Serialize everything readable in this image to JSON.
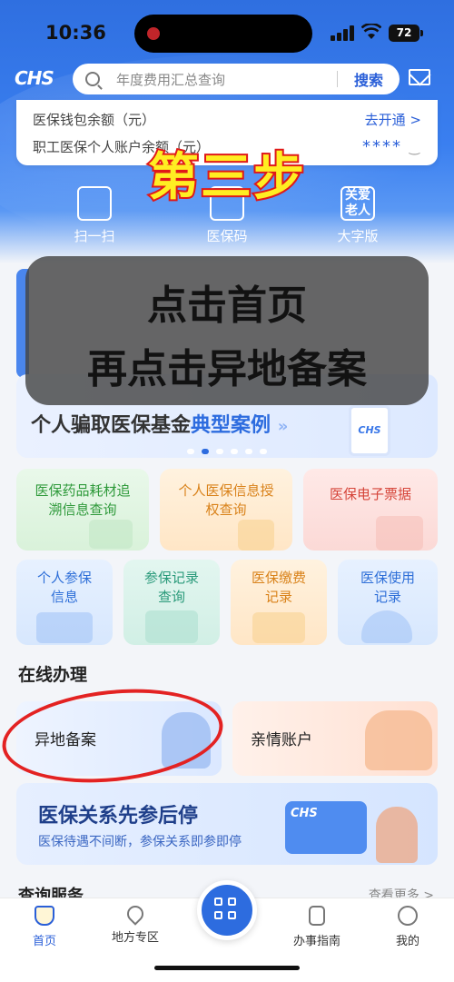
{
  "status_bar": {
    "time": "10:36",
    "battery": "72"
  },
  "header": {
    "logo": "CHS",
    "search_placeholder": "年度费用汇总查询",
    "search_button": "搜索"
  },
  "wallet": {
    "balance_label": "医保钱包余额（元）",
    "open_link": "去开通 >",
    "personal_label": "职工医保个人账户余额（元）",
    "personal_value": "****"
  },
  "quick_actions": [
    {
      "label": "扫一扫",
      "icon": "scan-icon"
    },
    {
      "label": "医保码",
      "icon": "qr-code-icon"
    },
    {
      "label": "大字版",
      "icon": "elderly-care-icon",
      "icon_text": "关爱老人"
    }
  ],
  "overlay": {
    "step": "第三步",
    "line1": "点击首页",
    "line2": "再点击异地备案"
  },
  "fraud_banner": {
    "text": "个人骗取医保基金",
    "highlight": "典型案例",
    "arrow": "»",
    "logo": "CHS"
  },
  "service_cards_row1": [
    {
      "label": "医保药品耗材追溯信息查询",
      "line1": "医保药品耗材追",
      "line2": "溯信息查询",
      "color": "#2f9a3b"
    },
    {
      "label": "个人医保信息授权查询",
      "line1": "个人医保信息授",
      "line2": "权查询",
      "color": "#d9821a"
    },
    {
      "label": "医保电子票据",
      "line1": "医保电子票据",
      "line2": "",
      "color": "#d6453a"
    }
  ],
  "service_cards_row2": [
    {
      "line1": "个人参保",
      "line2": "信息",
      "color": "#2e6fd8"
    },
    {
      "line1": "参保记录",
      "line2": "查询",
      "color": "#2a9a7a"
    },
    {
      "line1": "医保缴费",
      "line2": "记录",
      "color": "#d9821a"
    },
    {
      "line1": "医保使用",
      "line2": "记录",
      "color": "#2e6fd8"
    }
  ],
  "online_section": {
    "title": "在线办理",
    "items": [
      {
        "label": "异地备案"
      },
      {
        "label": "亲情账户"
      }
    ]
  },
  "relation_banner": {
    "title": "医保关系先参后停",
    "subtitle": "医保待遇不间断，参保关系即参即停",
    "card_logo": "CHS"
  },
  "query_section": {
    "title": "查询服务",
    "more": "查看更多 >"
  },
  "tabbar": {
    "items": [
      {
        "label": "首页",
        "icon": "home-shield-icon",
        "active": true
      },
      {
        "label": "地方专区",
        "icon": "location-pin-icon",
        "active": false
      },
      {
        "label": "办事指南",
        "icon": "document-icon",
        "active": false
      },
      {
        "label": "我的",
        "icon": "profile-icon",
        "active": false
      }
    ],
    "center_icon": "qr-scan-fab-icon"
  },
  "colors": {
    "primary": "#2d6cdf",
    "annotation_red": "#e32222",
    "step_yellow": "#ffee22"
  }
}
